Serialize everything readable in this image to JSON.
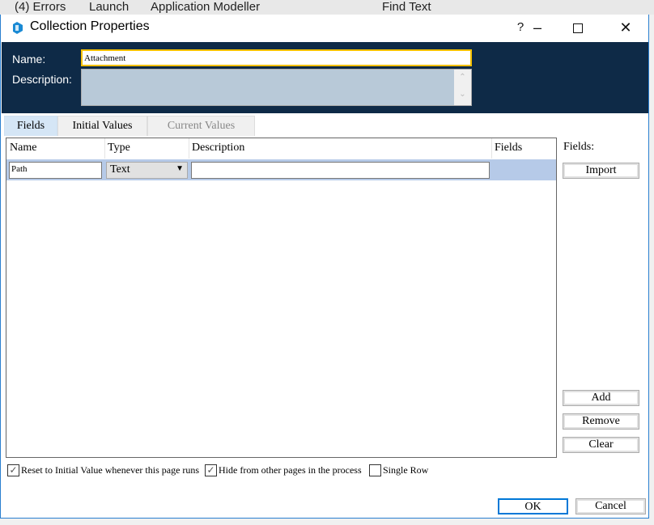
{
  "background_app": {
    "items": [
      "(4) Errors",
      "Launch",
      "Application Modeller",
      "Find Text"
    ]
  },
  "dialog": {
    "title": "Collection Properties",
    "help_label": "?",
    "name_label": "Name:",
    "name_value": "Attachment",
    "description_label": "Description:",
    "description_value": "",
    "tabs": [
      {
        "label": "Fields",
        "active": true
      },
      {
        "label": "Initial Values",
        "active": false
      },
      {
        "label": "Current Values",
        "active": false,
        "disabled": true
      }
    ],
    "grid": {
      "columns": [
        "Name",
        "Type",
        "Description",
        "Fields"
      ],
      "rows": [
        {
          "name": "Path",
          "type": "Text",
          "description": "",
          "fields": ""
        }
      ]
    },
    "side": {
      "fields_label": "Fields:",
      "import": "Import",
      "add": "Add",
      "remove": "Remove",
      "clear": "Clear"
    },
    "checkboxes": [
      {
        "label": "Reset to Initial Value whenever this page runs",
        "checked": true
      },
      {
        "label": "Hide from other pages in the process",
        "checked": true
      },
      {
        "label": "Single Row",
        "checked": false
      }
    ],
    "ok": "OK",
    "cancel": "Cancel"
  },
  "colors": {
    "header_bg": "#0e2a47",
    "focus_border": "#f5c000",
    "selected_row": "#b6cae8",
    "active_tab": "#d5e6f6"
  }
}
